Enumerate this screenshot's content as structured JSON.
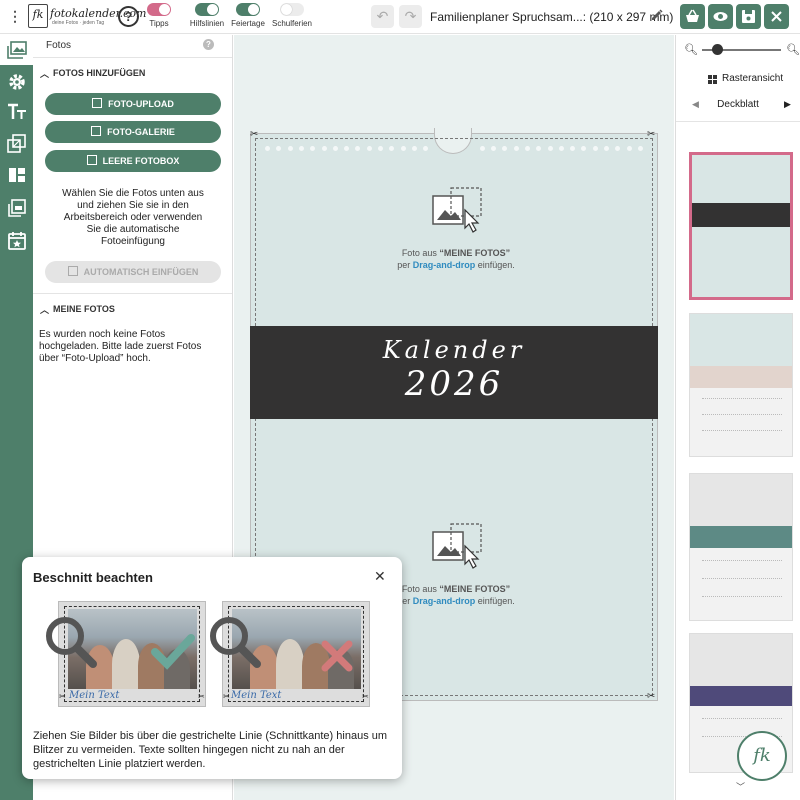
{
  "topbar": {
    "logo_mark": "fk",
    "logo_text": "fotokalender.com",
    "logo_subtext": "deine Fotos · jeden Tag",
    "help_symbol": "?",
    "toggles": [
      {
        "label": "Tipps",
        "on": true,
        "color": "#d36a8a"
      },
      {
        "label": "Hilfslinien",
        "on": true,
        "color": "#4e7f6a"
      },
      {
        "label": "Feiertage",
        "on": true,
        "color": "#4e7f6a"
      },
      {
        "label": "Schulferien",
        "on": false,
        "color": "#e4e4e4"
      }
    ],
    "document_title": "Familienplaner Spruchsam...: (210 x 297 mm)"
  },
  "sidebar": {
    "icons": [
      "photos-icon",
      "gear-icon",
      "text-icon",
      "layers-icon",
      "layout-icon",
      "calendar-photo-icon",
      "calendar-star-icon"
    ]
  },
  "panel": {
    "title": "Fotos",
    "help_symbol": "?",
    "add_section": {
      "heading": "FOTOS HINZUFÜGEN",
      "buttons": [
        "FOTO-UPLOAD",
        "FOTO-GALERIE",
        "LEERE FOTOBOX"
      ],
      "hint_lines": [
        "Wählen Sie die Fotos unten aus",
        "und ziehen Sie sie in den",
        "Arbeitsbereich oder verwenden",
        "Sie die automatische",
        "Fotoeinfügung"
      ],
      "auto_button": "AUTOMATISCH EINFÜGEN"
    },
    "my_photos": {
      "heading": "MEINE FOTOS",
      "text_lines": [
        "Es wurden noch keine Fotos",
        "hochgeladen. Bitte lade zuerst Fotos",
        "über “Foto-Upload” hoch."
      ]
    }
  },
  "canvas": {
    "band_script": "Kalender",
    "band_year": "2026",
    "placeholder": {
      "prefix": "Foto aus ",
      "highlight": "“MEINE FOTOS”",
      "line2_prefix": "per ",
      "line2_link": "Drag-and-drop",
      "line2_suffix": " einfügen."
    }
  },
  "right_panel": {
    "view_label": "Rasteransicht",
    "nav_label": "Deckblatt"
  },
  "popup": {
    "title": "Beschnitt beachten",
    "caption_good": "Mein Text",
    "caption_bad": "Mein Text",
    "text": "Ziehen Sie Bilder bis über die gestrichelte Linie (Schnittkante) hinaus um Blitzer zu vermeiden. Texte sollten hingegen nicht zu nah an der gestrichelten Linie platziert werden."
  },
  "colors": {
    "accent": "#4e7f6a",
    "pink": "#d36a8a",
    "page_bg": "#d9e6e5",
    "band": "#333232"
  }
}
